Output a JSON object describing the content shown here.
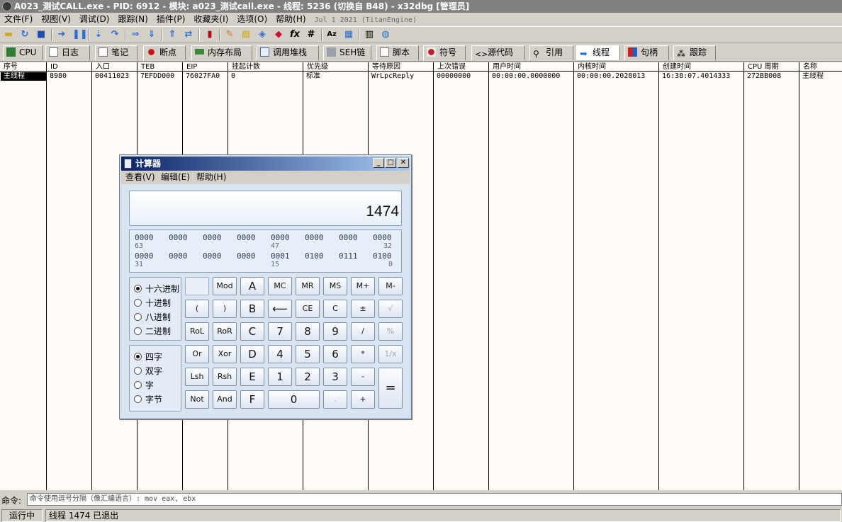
{
  "window": {
    "title": "A023_测试CALL.exe - PID: 6912 - 模块: a023_测试call.exe - 线程: 5236 (切换自 B48) - x32dbg [管理员]"
  },
  "menu": [
    "文件(F)",
    "视图(V)",
    "调试(D)",
    "跟踪(N)",
    "插件(P)",
    "收藏夹(I)",
    "选项(O)",
    "帮助(H)"
  ],
  "version": "Jul 1 2021 (TitanEngine)",
  "tabs": [
    "CPU",
    "日志",
    "笔记",
    "断点",
    "内存布局",
    "调用堆栈",
    "SEH链",
    "脚本",
    "符号",
    "源代码",
    "引用",
    "线程",
    "句柄",
    "跟踪"
  ],
  "threads": {
    "columns": [
      "序号",
      "ID",
      "入口",
      "TEB",
      "EIP",
      "挂起计数",
      "优先级",
      "等待原因",
      "上次错误",
      "用户时间",
      "内核时间",
      "创建时间",
      "CPU 周期",
      "名称"
    ],
    "rows": [
      {
        "number": "主线程",
        "id": "8980",
        "entry": "00411023",
        "teb": "7EFDD000",
        "eip": "76027FA0",
        "suspend_count": "0",
        "priority": "标准",
        "wait_reason": "WrLpcReply",
        "last_error": "00000000",
        "user_time": "00:00:00.0000000",
        "kernel_time": "00:00:00.2028013",
        "creation_time": "16:38:07.4014333",
        "cpu_cycles": "272BB008",
        "name": "主线程"
      }
    ]
  },
  "command": {
    "label": "命令:",
    "placeholder": "命令使用逗号分隔（像汇编语言）: mov eax, ebx"
  },
  "status": {
    "state": "运行中",
    "message": "线程 1474 已退出"
  },
  "calculator": {
    "title": "计算器",
    "menu": [
      "查看(V)",
      "编辑(E)",
      "帮助(H)"
    ],
    "display": "1474",
    "bits_row1": [
      "0000",
      "0000",
      "0000",
      "0000",
      "0000",
      "0000",
      "0000",
      "0000"
    ],
    "bit_labels_row1": [
      "63",
      "47",
      "32"
    ],
    "bits_row2": [
      "0000",
      "0000",
      "0000",
      "0000",
      "0001",
      "0100",
      "0111",
      "0100"
    ],
    "bit_labels_row2": [
      "31",
      "15",
      "0"
    ],
    "bases": [
      "十六进制",
      "十进制",
      "八进制",
      "二进制"
    ],
    "word_sizes": [
      "四字",
      "双字",
      "字",
      "字节"
    ],
    "keys": {
      "mod": "Mod",
      "a": "A",
      "mc": "MC",
      "mr": "MR",
      "ms": "MS",
      "mplus": "M+",
      "mminus": "M-",
      "lparen": "(",
      "rparen": ")",
      "b": "B",
      "backspace": "⟵",
      "ce": "CE",
      "c": "C",
      "plusminus": "±",
      "sqrt": "√",
      "rol": "RoL",
      "ror": "RoR",
      "hex_c": "C",
      "d7": "7",
      "d8": "8",
      "d9": "9",
      "divide": "/",
      "percent": "%",
      "or": "Or",
      "xor": "Xor",
      "d": "D",
      "d4": "4",
      "d5": "5",
      "d6": "6",
      "multiply": "*",
      "reciprocal": "1/x",
      "lsh": "Lsh",
      "rsh": "Rsh",
      "e": "E",
      "d1": "1",
      "d2": "2",
      "d3": "3",
      "subtract": "-",
      "equals": "=",
      "not": "Not",
      "and": "And",
      "f": "F",
      "d0": "0",
      "decimal": ".",
      "add": "+"
    }
  },
  "colors": {
    "title_bar_inactive": "#808080",
    "grid_background": "#fffaf5",
    "selection": "#000000",
    "calc_title_start": "#0a2468",
    "calc_title_end": "#a6caf0"
  }
}
